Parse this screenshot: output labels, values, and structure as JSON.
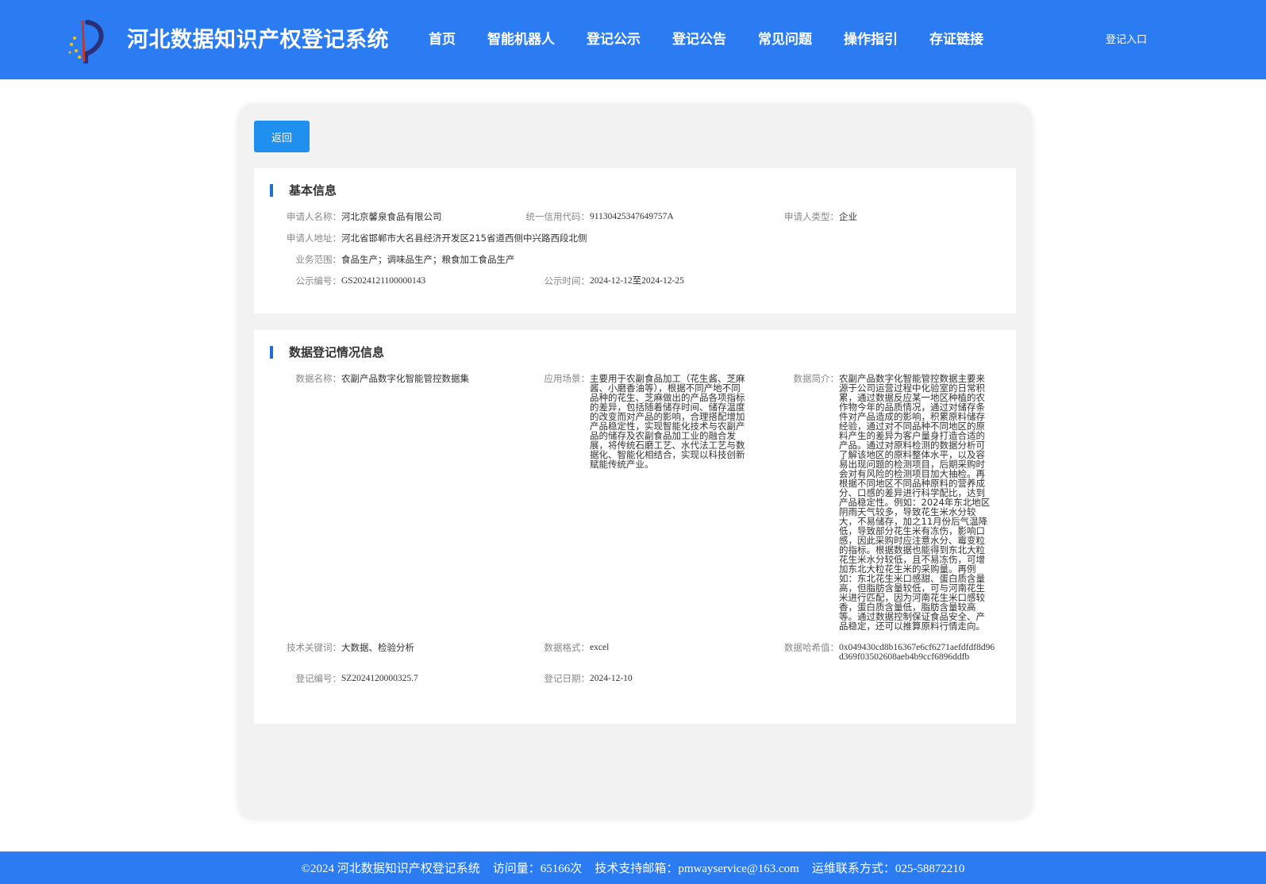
{
  "header": {
    "title": "河北数据知识产权登记系统",
    "nav": [
      "首页",
      "智能机器人",
      "登记公示",
      "登记公告",
      "常见问题",
      "操作指引",
      "存证链接"
    ],
    "login": "登记入口"
  },
  "main": {
    "back_label": "返回",
    "basic": {
      "title": "基本信息",
      "applicant_name_label": "申请人名称：",
      "applicant_name": "河北京馨泉食品有限公司",
      "credit_code_label": "统一信用代码：",
      "credit_code": "91130425347649757A",
      "applicant_type_label": "申请人类型：",
      "applicant_type": "企业",
      "address_label": "申请人地址：",
      "address": "河北省邯郸市大名县经济开发区215省道西侧中兴路西段北侧",
      "scope_label": "业务范围：",
      "scope": "食品生产；调味品生产；粮食加工食品生产",
      "notice_no_label": "公示编号：",
      "notice_no": "GS2024121100000143",
      "notice_time_label": "公示时间：",
      "notice_time": "2024-12-12至2024-12-25"
    },
    "data": {
      "title": "数据登记情况信息",
      "name_label": "数据名称：",
      "name": "农副产品数字化智能管控数据集",
      "scenario_label": "应用场景：",
      "scenario": "主要用于农副食品加工（花生酱、芝麻酱、小磨香油等），根据不同产地不同品种的花生、芝麻做出的产品各项指标的差异，包括随着储存时间、储存温度的改变而对产品的影响，合理搭配增加产品稳定性，实现智能化技术与农副产品的储存及农副食品加工业的融合发展，将传统石磨工艺、水代法工艺与数据化、智能化相结合，实现以科技创新赋能传统产业。",
      "intro_label": "数据简介：",
      "intro": "农副产品数字化智能管控数据主要来源于公司运营过程中化验室的日常积累，通过数据反应某一地区种植的农作物今年的品质情况，通过对储存条件对产品造成的影响，积累原料储存经验，通过对不同品种不同地区的原料产生的差异为客户量身打造合适的产品。通过对原料检测的数据分析可了解该地区的原料整体水平，以及容易出现问题的检测项目，后期采购时会对有风险的检测项目加大抽检。再根据不同地区不同品种原料的营养成分、口感的差异进行科学配比，达到产品稳定性。例如：2024年东北地区阴雨天气较多，导致花生米水分较大，不易储存，加之11月份后气温降低，导致部分花生米有冻伤，影响口感，因此采购时应注意水分、霉变粒的指标。根据数据也能得到东北大粒花生米水分较低，且不易冻伤，可增加东北大粒花生米的采购量。再例如：东北花生米口感甜、蛋白质含量高，但脂肪含量较低，可与河南花生米进行匹配，因为河南花生米口感较香，蛋白质含量低，脂肪含量较高等。通过数据控制保证食品安全、产品稳定，还可以推算原料行情走向。",
      "keywords_label": "技术关键词：",
      "keywords": "大数据、检验分析",
      "format_label": "数据格式：",
      "format": "excel",
      "hash_label": "数据哈希值：",
      "hash": "0x049430cd8b16367e6cf6271aefdfdf8d96d369f03502608aeb4b9ccf6896ddfb",
      "reg_no_label": "登记编号：",
      "reg_no": "SZ2024120000325.7",
      "reg_date_label": "登记日期：",
      "reg_date": "2024-12-10"
    }
  },
  "footer": {
    "copyright": "©2024 河北数据知识产权登记系统",
    "visits": "访问量：65166次",
    "email": "技术支持邮箱：pmwayservice@163.com",
    "phone": "运维联系方式：025-58872210"
  },
  "colors": {
    "header_bg": "#2b7cf2",
    "button_bg": "#1f8ff0",
    "section_bar": "#1f6fd0"
  }
}
